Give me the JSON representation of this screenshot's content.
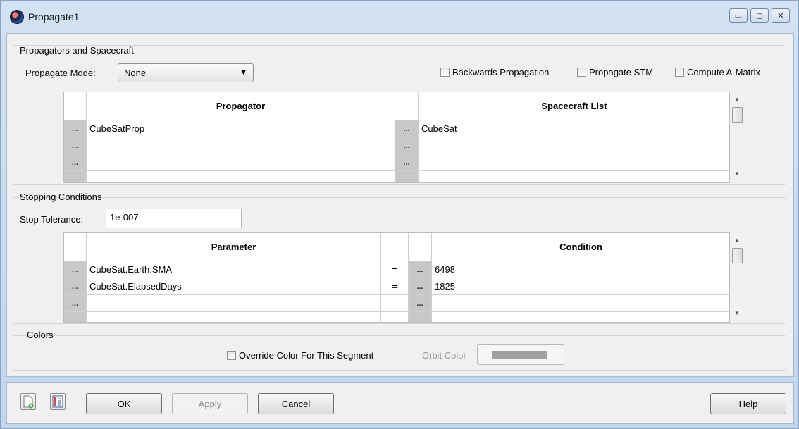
{
  "window": {
    "title": "Propagate1",
    "controls": [
      "minimize-icon",
      "maximize-icon",
      "close-icon"
    ]
  },
  "propagators": {
    "group_title": "Propagators and Spacecraft",
    "mode_label": "Propagate Mode:",
    "mode_value": "None",
    "checkboxes": [
      {
        "label": "Backwards Propagation",
        "checked": false
      },
      {
        "label": "Propagate STM",
        "checked": false
      },
      {
        "label": "Compute A-Matrix",
        "checked": false
      }
    ],
    "columns": [
      "Propagator",
      "Spacecraft List"
    ],
    "row_button": "...",
    "rows": [
      {
        "propagator": "CubeSatProp",
        "spacecraft": "CubeSat"
      },
      {
        "propagator": "",
        "spacecraft": ""
      },
      {
        "propagator": "",
        "spacecraft": ""
      },
      {
        "propagator": "",
        "spacecraft": ""
      }
    ]
  },
  "stopping": {
    "group_title": "Stopping Conditions",
    "tolerance_label": "Stop Tolerance:",
    "tolerance_value": "1e-007",
    "columns": [
      "Parameter",
      "",
      "Condition"
    ],
    "rows": [
      {
        "parameter": "CubeSat.Earth.SMA",
        "op": "=",
        "condition": "6498"
      },
      {
        "parameter": "CubeSat.ElapsedDays",
        "op": "=",
        "condition": "1825"
      },
      {
        "parameter": "",
        "op": "",
        "condition": ""
      },
      {
        "parameter": "",
        "op": "",
        "condition": ""
      }
    ]
  },
  "colors": {
    "group_title": "Colors",
    "override_label": "Override Color For This Segment",
    "override_checked": false,
    "orbit_color_label": "Orbit Color",
    "orbit_color_value": "#a0a0a0"
  },
  "buttons": {
    "ok": "OK",
    "apply": "Apply",
    "cancel": "Cancel",
    "help": "Help"
  },
  "icons": {
    "new_script": "new-script-icon",
    "show_script": "show-script-icon"
  }
}
